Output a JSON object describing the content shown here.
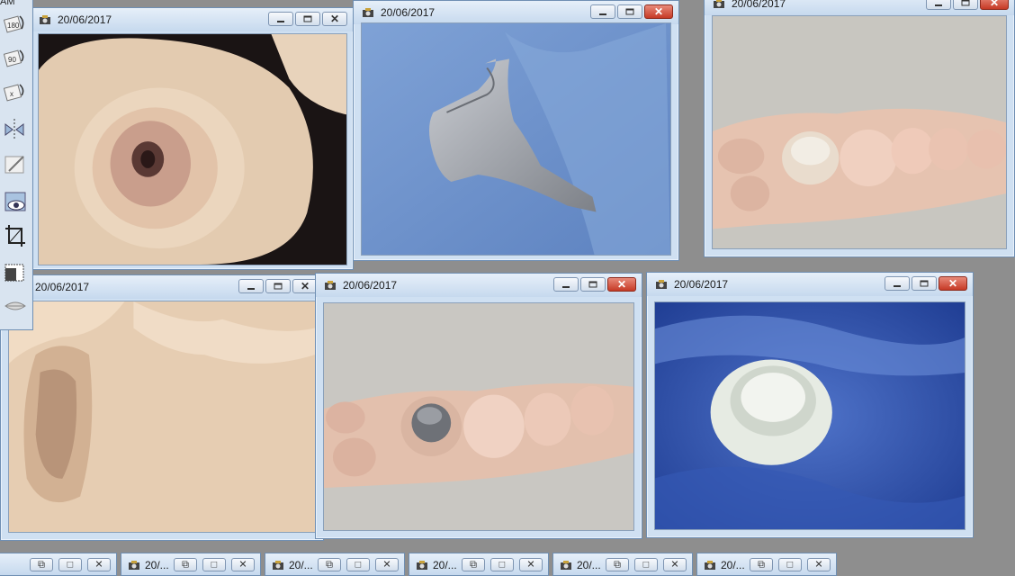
{
  "toolbar": {
    "top_label": "AM",
    "tools": [
      "rotate-180-icon",
      "rotate-90-icon",
      "rotate-x-icon",
      "flip-icon",
      "pen-icon",
      "eye-icon",
      "crop-icon",
      "contrast-icon",
      "lips-icon"
    ],
    "tool_labels": {
      "rotate_180": "180",
      "rotate_90": "90",
      "rotate_x": "x"
    }
  },
  "windows": [
    {
      "id": "w1",
      "title": "20/06/2017",
      "subject": "scan-soft-tissue-closeup"
    },
    {
      "id": "w2",
      "title": "20/06/2017",
      "subject": "metal-post-core"
    },
    {
      "id": "w3",
      "title": "20/06/2017",
      "subject": "crown-on-model"
    },
    {
      "id": "w4",
      "title": "20/06/2017",
      "subject": "scan-soft-tissue-2"
    },
    {
      "id": "w5",
      "title": "20/06/2017",
      "subject": "metal-core-on-model"
    },
    {
      "id": "w6",
      "title": "20/06/2017",
      "subject": "ceramic-crown-in-glove"
    }
  ],
  "taskbar": {
    "items": [
      {
        "label": ""
      },
      {
        "label": "20/..."
      },
      {
        "label": "20/..."
      },
      {
        "label": "20/..."
      },
      {
        "label": "20/..."
      },
      {
        "label": "20/..."
      }
    ]
  },
  "colors": {
    "title_gradient_top": "#e6eff9",
    "title_gradient_bottom": "#c6d9ee",
    "close_red": "#c63a26",
    "desktop": "#8e8e8e"
  }
}
